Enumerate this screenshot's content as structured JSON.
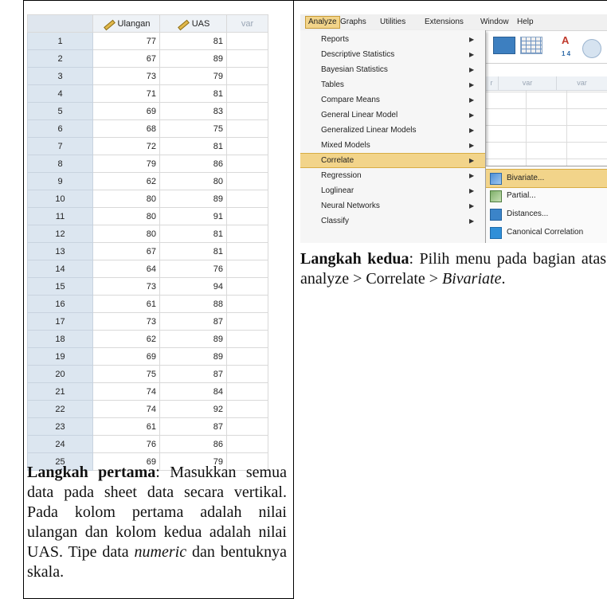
{
  "sheet": {
    "headers": [
      "",
      "Ulangan",
      "UAS",
      "var"
    ],
    "rows": [
      [
        "1",
        "77",
        "81"
      ],
      [
        "2",
        "67",
        "89"
      ],
      [
        "3",
        "73",
        "79"
      ],
      [
        "4",
        "71",
        "81"
      ],
      [
        "5",
        "69",
        "83"
      ],
      [
        "6",
        "68",
        "75"
      ],
      [
        "7",
        "72",
        "81"
      ],
      [
        "8",
        "79",
        "86"
      ],
      [
        "9",
        "62",
        "80"
      ],
      [
        "10",
        "80",
        "89"
      ],
      [
        "11",
        "80",
        "91"
      ],
      [
        "12",
        "80",
        "81"
      ],
      [
        "13",
        "67",
        "81"
      ],
      [
        "14",
        "64",
        "76"
      ],
      [
        "15",
        "73",
        "94"
      ],
      [
        "16",
        "61",
        "88"
      ],
      [
        "17",
        "73",
        "87"
      ],
      [
        "18",
        "62",
        "89"
      ],
      [
        "19",
        "69",
        "89"
      ],
      [
        "20",
        "75",
        "87"
      ],
      [
        "21",
        "74",
        "84"
      ],
      [
        "22",
        "74",
        "92"
      ],
      [
        "23",
        "61",
        "87"
      ],
      [
        "24",
        "76",
        "86"
      ],
      [
        "25",
        "69",
        "79"
      ]
    ]
  },
  "caption1": {
    "bold": "Langkah pertama",
    "text": ": Masukkan semua data pada sheet data secara vertikal. Pada kolom pertama adalah nilai ulangan dan kolom kedua adalah nilai UAS. Tipe data ",
    "italic": "numeric",
    "tail": " dan bentuknya skala."
  },
  "spss": {
    "menubar": [
      "Analyze",
      "Graphs",
      "Utilities",
      "Extensions",
      "Window",
      "Help"
    ],
    "menu_items": [
      "Reports",
      "Descriptive Statistics",
      "Bayesian Statistics",
      "Tables",
      "Compare Means",
      "General Linear Model",
      "Generalized Linear Models",
      "Mixed Models",
      "Correlate",
      "Regression",
      "Loglinear",
      "Neural Networks",
      "Classify"
    ],
    "highlighted_index": 8,
    "submenu_items": [
      "Bivariate...",
      "Partial...",
      "Distances...",
      "Canonical Correlation"
    ],
    "submenu_icons": [
      "bivariate-icon",
      "partial-icon",
      "distances-icon",
      "canonical-correlation-icon"
    ],
    "submenu_highlighted": 0,
    "bg_columns": [
      "r",
      "var",
      "var"
    ],
    "toolbar_letter": "A",
    "toolbar_digits": "1 4"
  },
  "caption2": {
    "bold": "Langkah kedua",
    "text": ": Pilih menu pada bagian atas analyze > Correlate > ",
    "italic": "Bivariate",
    "tail": "."
  },
  "colors": {
    "highlight": "#f2d48a",
    "row_header": "#dce6f0"
  }
}
